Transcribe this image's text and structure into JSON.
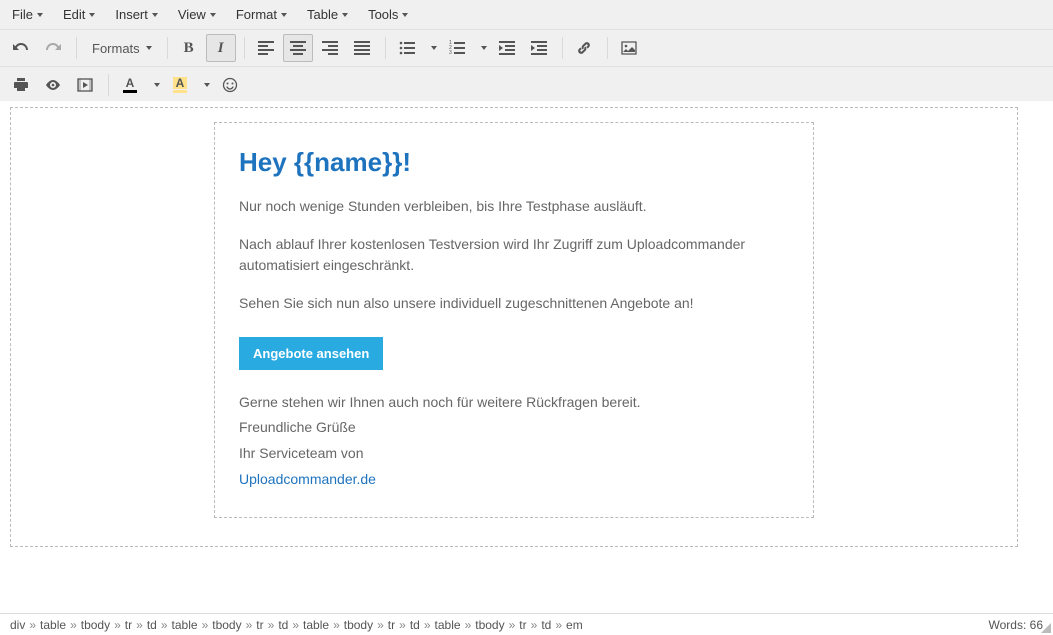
{
  "menubar": {
    "items": [
      {
        "label": "File"
      },
      {
        "label": "Edit"
      },
      {
        "label": "Insert"
      },
      {
        "label": "View"
      },
      {
        "label": "Format"
      },
      {
        "label": "Table"
      },
      {
        "label": "Tools"
      }
    ]
  },
  "toolbar": {
    "formats_label": "Formats"
  },
  "email": {
    "heading": "Hey {{name}}!",
    "p1": "Nur noch wenige Stunden verbleiben, bis Ihre Testphase ausläuft.",
    "p2": "Nach ablauf Ihrer kostenlosen Testversion wird Ihr Zugriff zum Uploadcommander automatisiert eingeschränkt.",
    "p3": "Sehen Sie sich nun also unsere individuell zugeschnittenen Angebote an!",
    "cta": "Angebote ansehen",
    "p4": "Gerne stehen wir Ihnen auch noch für weitere Rückfragen bereit.",
    "p5": "Freundliche Grüße",
    "p6": "Ihr Serviceteam von",
    "link": "Uploadcommander.de"
  },
  "status": {
    "path": [
      "div",
      "table",
      "tbody",
      "tr",
      "td",
      "table",
      "tbody",
      "tr",
      "td",
      "table",
      "tbody",
      "tr",
      "td",
      "table",
      "tbody",
      "tr",
      "td",
      "em"
    ],
    "words_label": "Words:",
    "words_count": "66"
  }
}
